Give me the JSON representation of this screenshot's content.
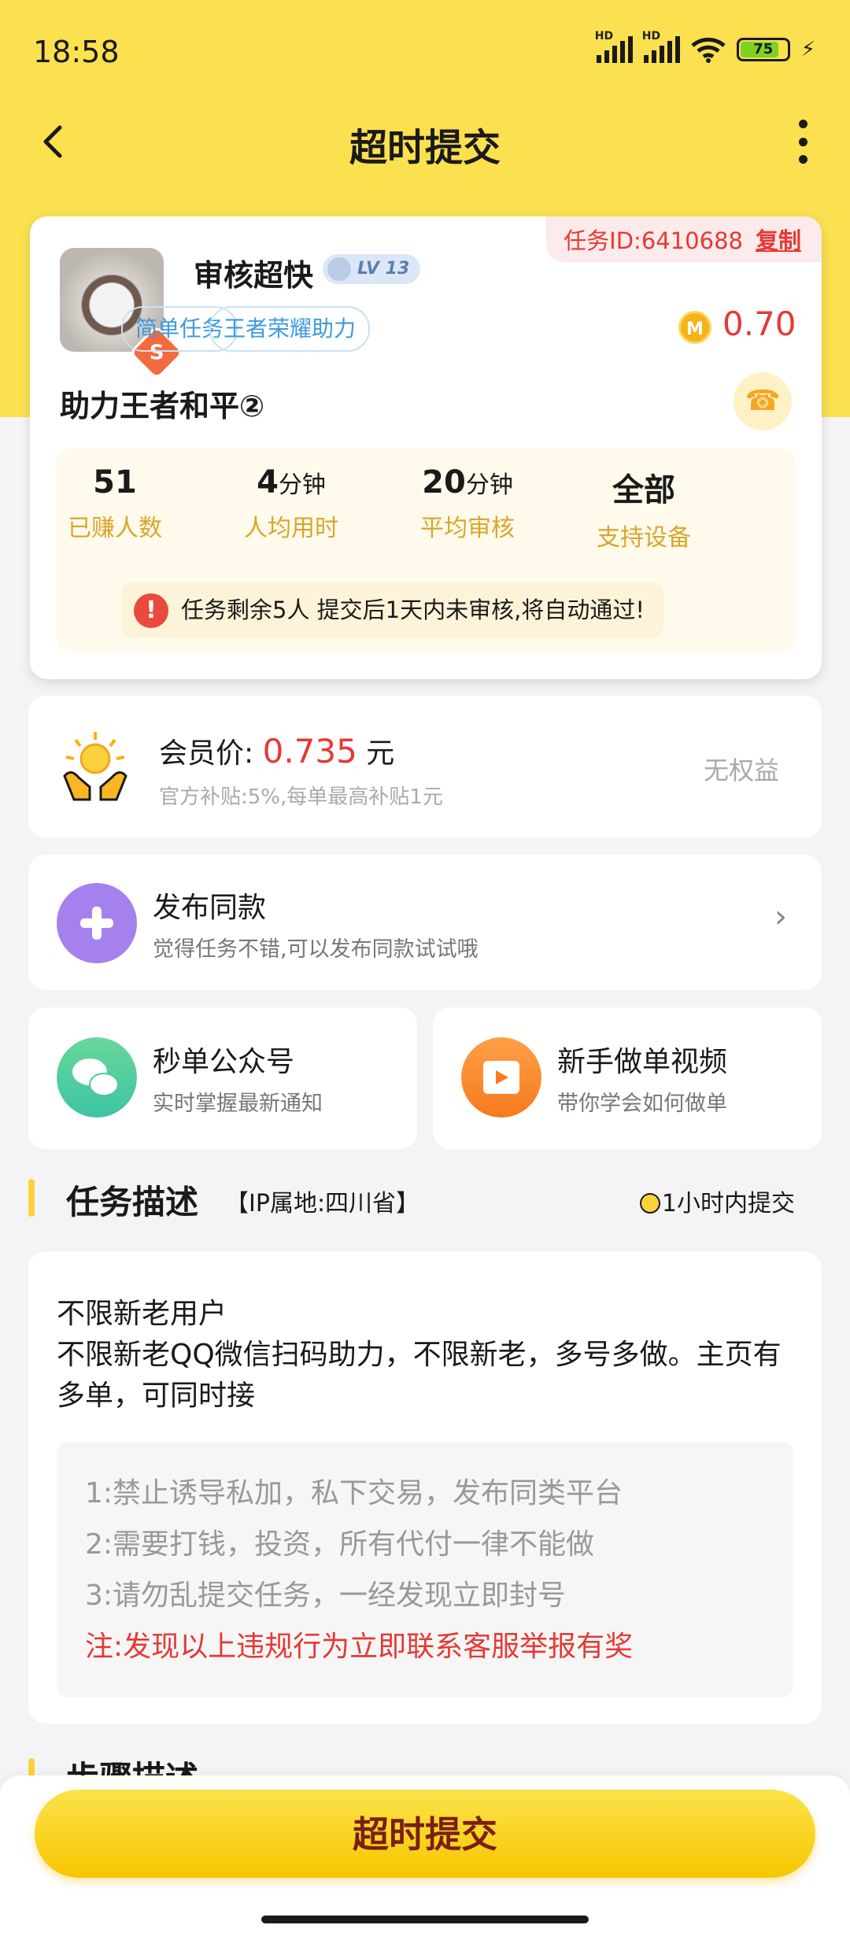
{
  "status_bar": {
    "time": "18:58",
    "hd1": "HD",
    "hd2": "HD",
    "battery": "75"
  },
  "header": {
    "title": "超时提交"
  },
  "task_card": {
    "task_id_label": "任务ID:6410688",
    "copy_label": "复制",
    "username": "审核超快",
    "level": "LV 13",
    "avatar_badge": "S",
    "tags": [
      "简单任务",
      "王者荣耀助力"
    ],
    "coin_letter": "M",
    "reward": "0.70",
    "title": "助力王者和平②",
    "stats": [
      {
        "value": "51",
        "unit": "",
        "label": "已赚人数"
      },
      {
        "value": "4",
        "unit": "分钟",
        "label": "人均用时"
      },
      {
        "value": "20",
        "unit": "分钟",
        "label": "平均审核"
      },
      {
        "value": "全部",
        "unit": "",
        "label": "支持设备"
      }
    ],
    "notice": "任务剩余5人  提交后1天内未审核,将自动通过!"
  },
  "member": {
    "label": "会员价:",
    "price": "0.735",
    "unit": "元",
    "sub": "官方补贴:5%,每单最高补贴1元",
    "status": "无权益"
  },
  "publish": {
    "title": "发布同款",
    "subtitle": "觉得任务不错,可以发布同款试试哦"
  },
  "shortcuts": [
    {
      "title": "秒单公众号",
      "subtitle": "实时掌握最新通知"
    },
    {
      "title": "新手做单视频",
      "subtitle": "带你学会如何做单"
    }
  ],
  "description": {
    "heading": "任务描述",
    "ip": "【IP属地:四川省】",
    "time_limit": "1小时内提交",
    "text": "不限新老用户\n不限新老QQ微信扫码助力，不限新老，多号多做。主页有多单，可同时接",
    "rules": [
      "1:禁止诱导私加，私下交易，发布同类平台",
      "2:需要打钱，投资，所有代付一律不能做",
      "3:请勿乱提交任务，一经发现立即封号",
      "注:发现以上违规行为立即联系客服举报有奖"
    ]
  },
  "steps": {
    "heading": "步骤描述"
  },
  "bottom": {
    "submit_label": "超时提交"
  },
  "colors": {
    "brand_yellow": "#fbe04f",
    "accent_red": "#e53935",
    "tag_blue": "#3c9ae0",
    "stat_gold": "#d9a62a"
  }
}
